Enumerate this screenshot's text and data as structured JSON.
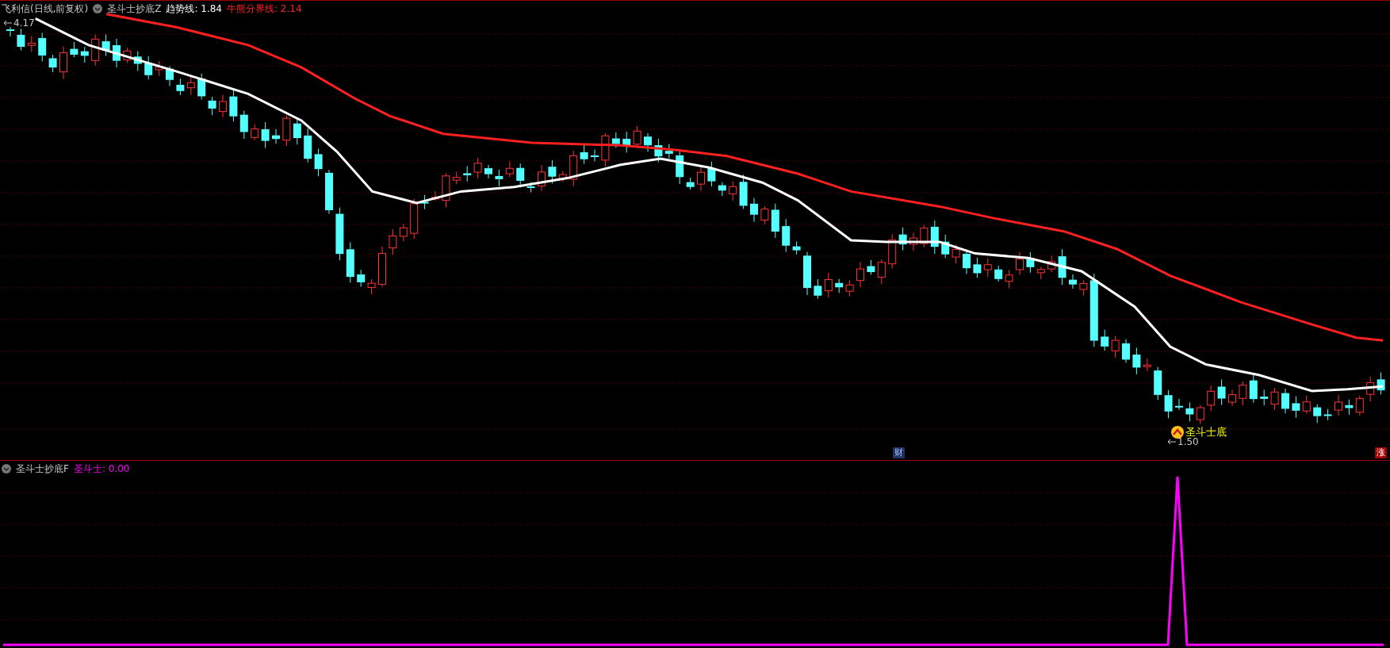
{
  "main_panel": {
    "security": "飞利信(日线,前复权)",
    "indicator": "圣斗士抄底Z",
    "lines": [
      {
        "text": "趋势线: 1.84",
        "color": "#ffffff"
      },
      {
        "text": "牛熊分界线: 2.14",
        "color": "#ff2020"
      }
    ],
    "high_marker": "4.17",
    "low_marker": "1.50",
    "signal_label": "圣斗士底",
    "event_markers": [
      {
        "text": "财",
        "kind": "finance"
      },
      {
        "text": "涨",
        "kind": "limit-up"
      }
    ]
  },
  "sub_panel": {
    "indicator": "圣斗士抄底F",
    "lines": [
      {
        "text": "圣斗士: 0.00",
        "color": "#ff00ff"
      }
    ]
  }
}
